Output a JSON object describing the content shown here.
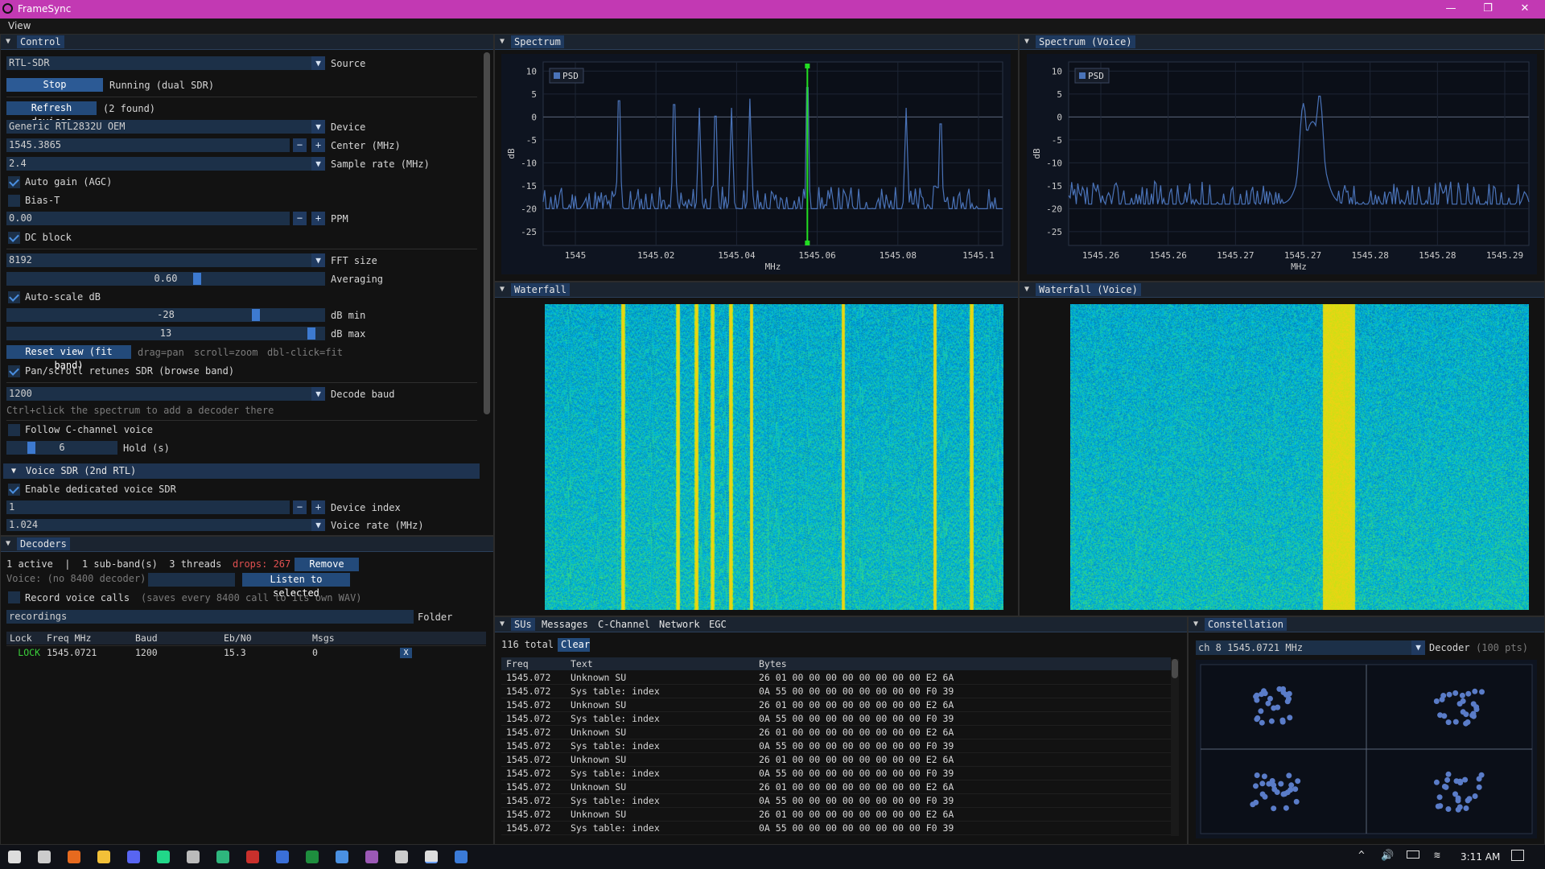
{
  "window": {
    "title": "FrameSync",
    "minimize": "—",
    "restore": "❐",
    "close": "✕"
  },
  "menu": {
    "view": "View"
  },
  "control": {
    "tab": "Control",
    "source_value": "RTL-SDR",
    "source_label": "Source",
    "stop_label": "Stop",
    "status": "Running (dual SDR)",
    "refresh_label": "Refresh devices",
    "found": "(2 found)",
    "device_value": "Generic RTL2832U OEM",
    "device_label": "Device",
    "center_value": "1545.3865",
    "center_label": "Center (MHz)",
    "rate_value": "2.4",
    "rate_label": "Sample rate (MHz)",
    "agc_label": "Auto gain (AGC)",
    "agc": true,
    "biast_label": "Bias-T",
    "biast": false,
    "ppm_value": "0.00",
    "ppm_label": "PPM",
    "dcblock_label": "DC block",
    "dcblock": true,
    "fft_value": "8192",
    "fft_label": "FFT size",
    "avg_value": "0.60",
    "avg_label": "Averaging",
    "avg_frac": 0.6,
    "autoscale_label": "Auto-scale dB",
    "autoscale": true,
    "dbmin_value": "-28",
    "dbmin_label": "dB min",
    "dbmin_frac": 0.79,
    "dbmax_value": "13",
    "dbmax_label": "dB max",
    "dbmax_frac": 0.97,
    "reset_label": "Reset view (fit band)",
    "hint_drag": "drag=pan",
    "hint_scroll": "scroll=zoom",
    "hint_dbl": "dbl-click=fit",
    "panscroll_label": "Pan/scroll retunes SDR (browse band)",
    "panscroll": true,
    "baud_value": "1200",
    "baud_label": "Decode baud",
    "ctrl_hint": "Ctrl+click the spectrum to add a decoder there",
    "follow_label": "Follow C-channel voice",
    "follow": false,
    "hold_value": "6",
    "hold_label": "Hold (s)",
    "hold_frac": 0.2,
    "voice_header": "Voice SDR (2nd RTL)",
    "enable_voice_label": "Enable dedicated voice SDR",
    "enable_voice": true,
    "devindex_value": "1",
    "devindex_label": "Device index",
    "voicerate_value": "1.024",
    "voicerate_label": "Voice rate (MHz)"
  },
  "decoders": {
    "tab": "Decoders",
    "summary": "1 active  |  1 sub-band(s)  3 threads",
    "drops": "drops: 267",
    "remove_all": "Remove all",
    "voice_status": "Voice: (no 8400 decoder)",
    "listen": "Listen to selected",
    "record_label": "Record voice calls",
    "record_hint": "(saves every 8400 call to its own WAV)",
    "record": false,
    "folder_value": "recordings",
    "folder_label": "Folder",
    "columns": [
      "Lock",
      "Freq MHz",
      "Baud",
      "Eb/N0",
      "Msgs"
    ],
    "rows": [
      {
        "lock": "LOCK",
        "freq": "1545.0721",
        "baud": "1200",
        "ebn0": "15.3",
        "msgs": "0",
        "x": "X"
      }
    ]
  },
  "spectrum": {
    "tab": "Spectrum",
    "legend": "PSD",
    "ylabel": "dB",
    "xlabel": "MHz",
    "xticks": [
      "1545",
      "1545.02",
      "1545.04",
      "1545.06",
      "1545.08",
      "1545.1"
    ],
    "yticks": [
      "10",
      "5",
      "0",
      "-5",
      "-10",
      "-15",
      "-20",
      "-25"
    ]
  },
  "spectrum_voice": {
    "tab": "Spectrum (Voice)",
    "legend": "PSD",
    "ylabel": "dB",
    "xlabel": "MHz",
    "xticks": [
      "1545.26",
      "1545.26",
      "1545.27",
      "1545.27",
      "1545.28",
      "1545.28",
      "1545.29"
    ],
    "yticks": [
      "10",
      "5",
      "0",
      "-5",
      "-10",
      "-15",
      "-20",
      "-25"
    ]
  },
  "waterfall": {
    "tab": "Waterfall"
  },
  "waterfall_voice": {
    "tab": "Waterfall (Voice)"
  },
  "messages": {
    "tabs": [
      "SUs",
      "Messages",
      "C-Channel",
      "Network",
      "EGC"
    ],
    "total": "116 total",
    "clear": "Clear",
    "columns": [
      "Freq",
      "Text",
      "Bytes"
    ],
    "rows": [
      [
        "1545.072",
        "Unknown SU",
        "26 01 00 00 00 00 00 00 00 00 E2 6A"
      ],
      [
        "1545.072",
        "Sys table: index",
        "0A 55 00 00 00 00 00 00 00 00 F0 39"
      ],
      [
        "1545.072",
        "Unknown SU",
        "26 01 00 00 00 00 00 00 00 00 E2 6A"
      ],
      [
        "1545.072",
        "Sys table: index",
        "0A 55 00 00 00 00 00 00 00 00 F0 39"
      ],
      [
        "1545.072",
        "Unknown SU",
        "26 01 00 00 00 00 00 00 00 00 E2 6A"
      ],
      [
        "1545.072",
        "Sys table: index",
        "0A 55 00 00 00 00 00 00 00 00 F0 39"
      ],
      [
        "1545.072",
        "Unknown SU",
        "26 01 00 00 00 00 00 00 00 00 E2 6A"
      ],
      [
        "1545.072",
        "Sys table: index",
        "0A 55 00 00 00 00 00 00 00 00 F0 39"
      ],
      [
        "1545.072",
        "Unknown SU",
        "26 01 00 00 00 00 00 00 00 00 E2 6A"
      ],
      [
        "1545.072",
        "Sys table: index",
        "0A 55 00 00 00 00 00 00 00 00 F0 39"
      ],
      [
        "1545.072",
        "Unknown SU",
        "26 01 00 00 00 00 00 00 00 00 E2 6A"
      ],
      [
        "1545.072",
        "Sys table: index",
        "0A 55 00 00 00 00 00 00 00 00 F0 39"
      ]
    ]
  },
  "constellation": {
    "tab": "Constellation",
    "channel": "ch 8  1545.0721 MHz",
    "decoder_label": "Decoder",
    "pts": "(100 pts)"
  },
  "taskbar": {
    "time": "3:11 AM",
    "icons": [
      "start-icon",
      "task-view-icon",
      "firefox-icon",
      "file-explorer-icon",
      "discord-icon",
      "pycharm-icon",
      "keyboard-icon",
      "app-icon",
      "filezilla-icon",
      "malwarebytes-icon",
      "sheets-icon",
      "app2-icon",
      "vs-icon",
      "terminal-icon",
      "framesync-icon",
      "powershell-icon"
    ]
  },
  "colors": {
    "titlebar": "#c239b3",
    "accent": "#2c5a95",
    "plot_line": "#4a73b8",
    "marker": "#22dd22",
    "lock": "#3bd13b",
    "drops": "#e05050"
  }
}
